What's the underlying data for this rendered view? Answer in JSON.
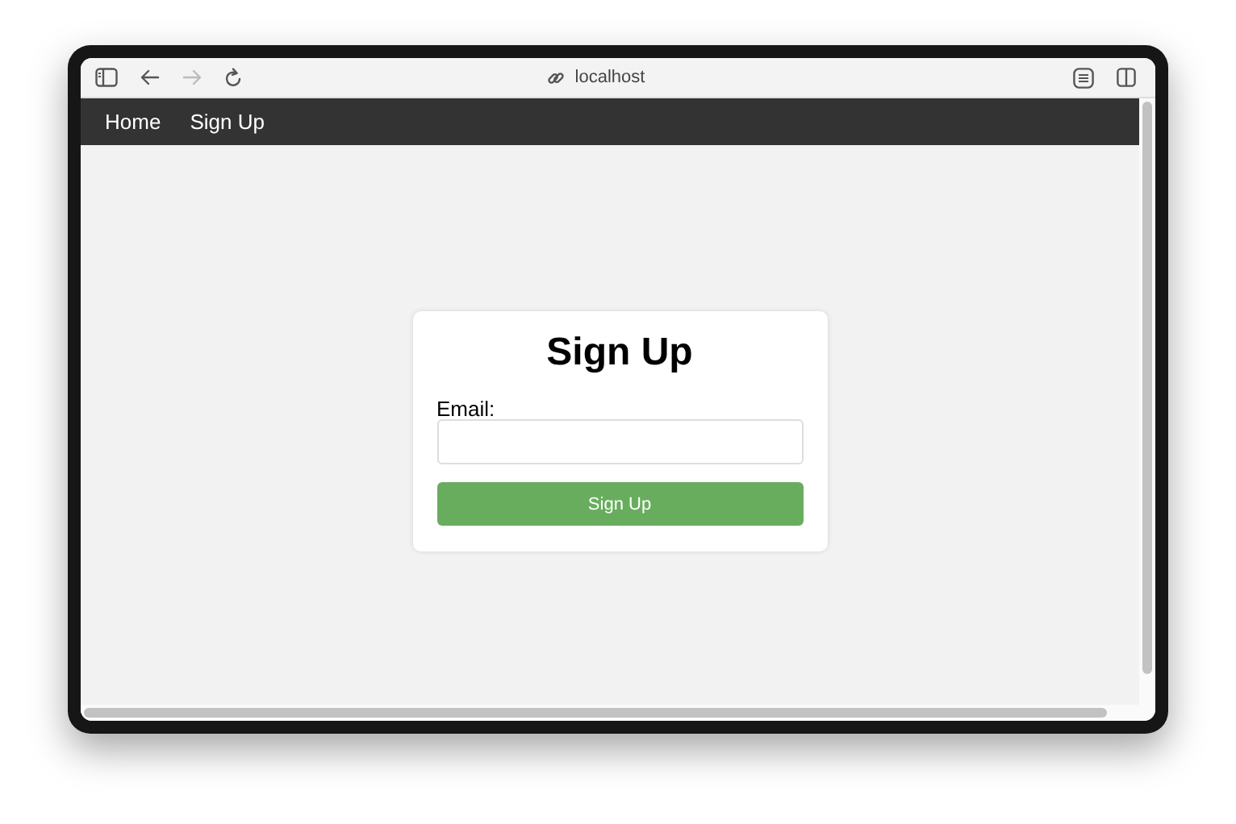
{
  "browser": {
    "address": "localhost",
    "nav_buttons": [
      {
        "kind": "back",
        "disabled": false
      },
      {
        "kind": "forward",
        "disabled": true
      },
      {
        "kind": "reload",
        "disabled": false
      }
    ]
  },
  "navbar": {
    "links": [
      "Home",
      "Sign Up"
    ]
  },
  "form": {
    "title": "Sign Up",
    "fields": [
      {
        "label": "Email:"
      }
    ],
    "submit": "Sign Up"
  }
}
